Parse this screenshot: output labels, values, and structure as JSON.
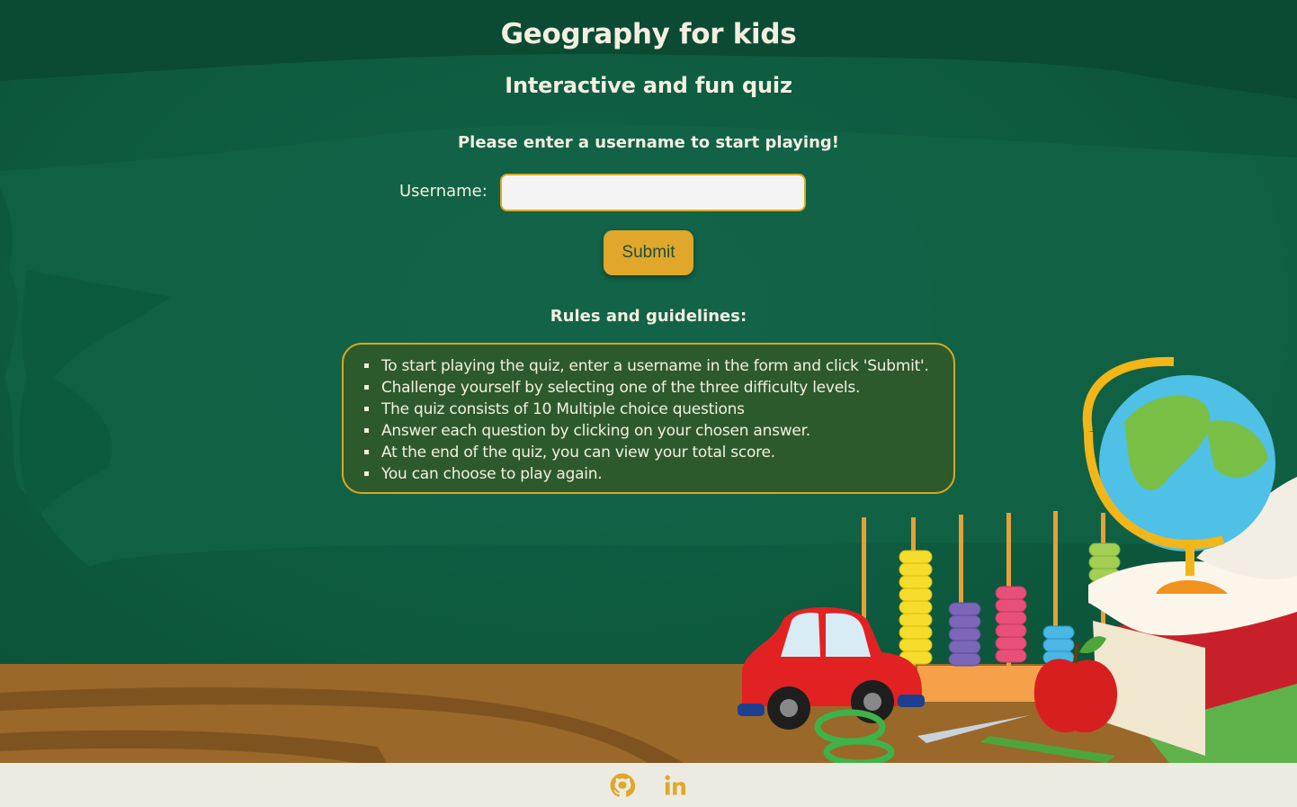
{
  "header": {
    "title": "Geography for kids",
    "subtitle": "Interactive and fun quiz"
  },
  "form": {
    "prompt": "Please enter a username to start playing!",
    "username_label": "Username:",
    "username_value": "",
    "submit_label": "Submit"
  },
  "rules": {
    "title": "Rules and guidelines:",
    "items": [
      "To start playing the quiz, enter a username in the form and click 'Submit'.",
      "Challenge yourself by selecting one of the three difficulty levels.",
      "The quiz consists of 10 Multiple choice questions",
      "Answer each question by clicking on your chosen answer.",
      "At the end of the quiz, you can view your total score.",
      "You can choose to play again."
    ]
  },
  "footer": {
    "icons": [
      "github-icon",
      "linkedin-icon"
    ]
  },
  "colors": {
    "background": "#0e5a3c",
    "accent": "#e1a72a",
    "rules_box": "#2d5a2c",
    "text": "#f3efe0",
    "footer": "#ecebe1"
  }
}
